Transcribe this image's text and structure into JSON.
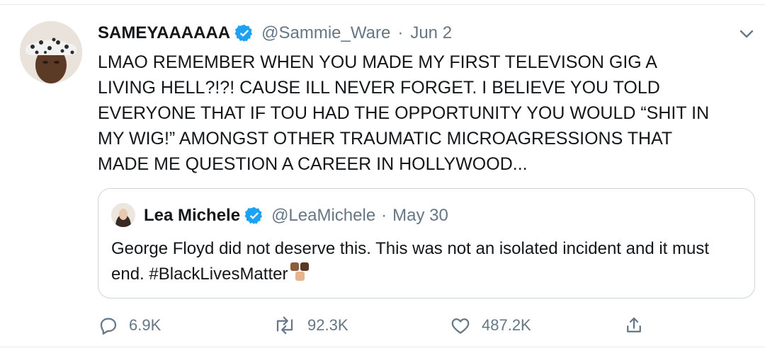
{
  "tweet": {
    "author_name": "SAMEYAAAAAA",
    "author_handle": "@Sammie_Ware",
    "separator": "·",
    "date": "Jun 2",
    "text": "LMAO REMEMBER WHEN YOU MADE MY FIRST TELEVISON GIG A\nLIVING HELL?!?! CAUSE ILL NEVER FORGET. I BELIEVE YOU TOLD\nEVERYONE THAT IF TOU HAD THE OPPORTUNITY YOU WOULD “SHIT IN\nMY WIG!” AMONGST OTHER TRAUMATIC MICROAGRESSIONS THAT\nMADE ME QUESTION A CAREER IN HOLLYWOOD...",
    "icons": {
      "verified": "verified-badge-icon",
      "more": "chevron-down-icon"
    }
  },
  "quoted_tweet": {
    "author_name": "Lea Michele",
    "author_handle": "@LeaMichele",
    "separator": "·",
    "date": "May 30",
    "text": "George Floyd did not deserve this. This was not an isolated incident and it must end. #BlackLivesMatter",
    "emoji": "fists-emoji"
  },
  "actions": {
    "reply_count": "6.9K",
    "retweet_count": "92.3K",
    "like_count": "487.2K"
  },
  "colors": {
    "verified": "#1da1f2",
    "secondary_text": "#657786",
    "primary_text": "#14171a",
    "border": "#ccd6dd"
  }
}
